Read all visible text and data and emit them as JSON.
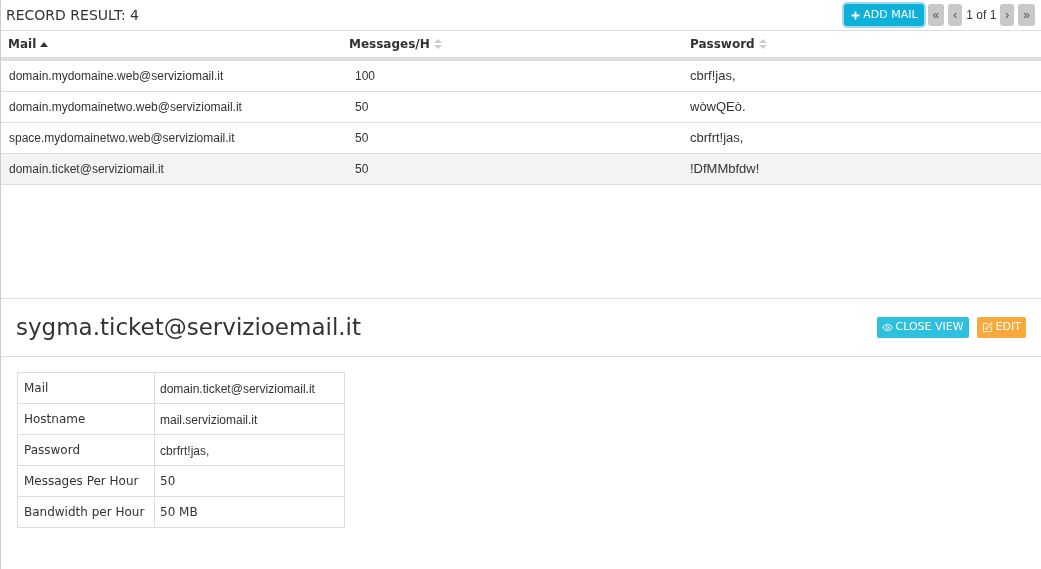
{
  "header": {
    "title": "RECORD RESULT: 4",
    "add_button": "ADD MAIL",
    "pager": {
      "first": "«",
      "prev": "‹",
      "text": "1 of 1",
      "next": "›",
      "last": "»"
    }
  },
  "table": {
    "columns": [
      {
        "label": "Mail",
        "sorted": true
      },
      {
        "label": "Messages/H",
        "sorted": false
      },
      {
        "label": "Password",
        "sorted": false
      }
    ],
    "rows": [
      {
        "cells": [
          "domain.mydomaine.web@serviziomail.it",
          "100",
          "cbrf!jas,"
        ],
        "selected": false
      },
      {
        "cells": [
          "domain.mydomainetwo.web@serviziomail.it",
          "50",
          "wòwQEò."
        ],
        "selected": false
      },
      {
        "cells": [
          "space.mydomainetwo.web@serviziomail.it",
          "50",
          "cbrfrt!jas,"
        ],
        "selected": false
      },
      {
        "cells": [
          "domain.ticket@serviziomail.it",
          "50",
          "!DfMMbfdw!"
        ],
        "selected": true
      }
    ]
  },
  "detail": {
    "title": "sygma.ticket@servizioemail.it",
    "close_button": "CLOSE VIEW",
    "edit_button": "EDIT",
    "fields": [
      {
        "label": "Mail",
        "value": "domain.ticket@serviziomail.it",
        "kind": "mono"
      },
      {
        "label": "Hostname",
        "value": "mail.serviziomail.it",
        "kind": "mono"
      },
      {
        "label": "Password",
        "value": "cbrfrt!jas,",
        "kind": "mono"
      },
      {
        "label": "Messages Per Hour",
        "value": "50",
        "kind": "plain"
      },
      {
        "label": "Bandwidth per Hour",
        "value": "50 MB",
        "kind": "plain"
      }
    ]
  }
}
